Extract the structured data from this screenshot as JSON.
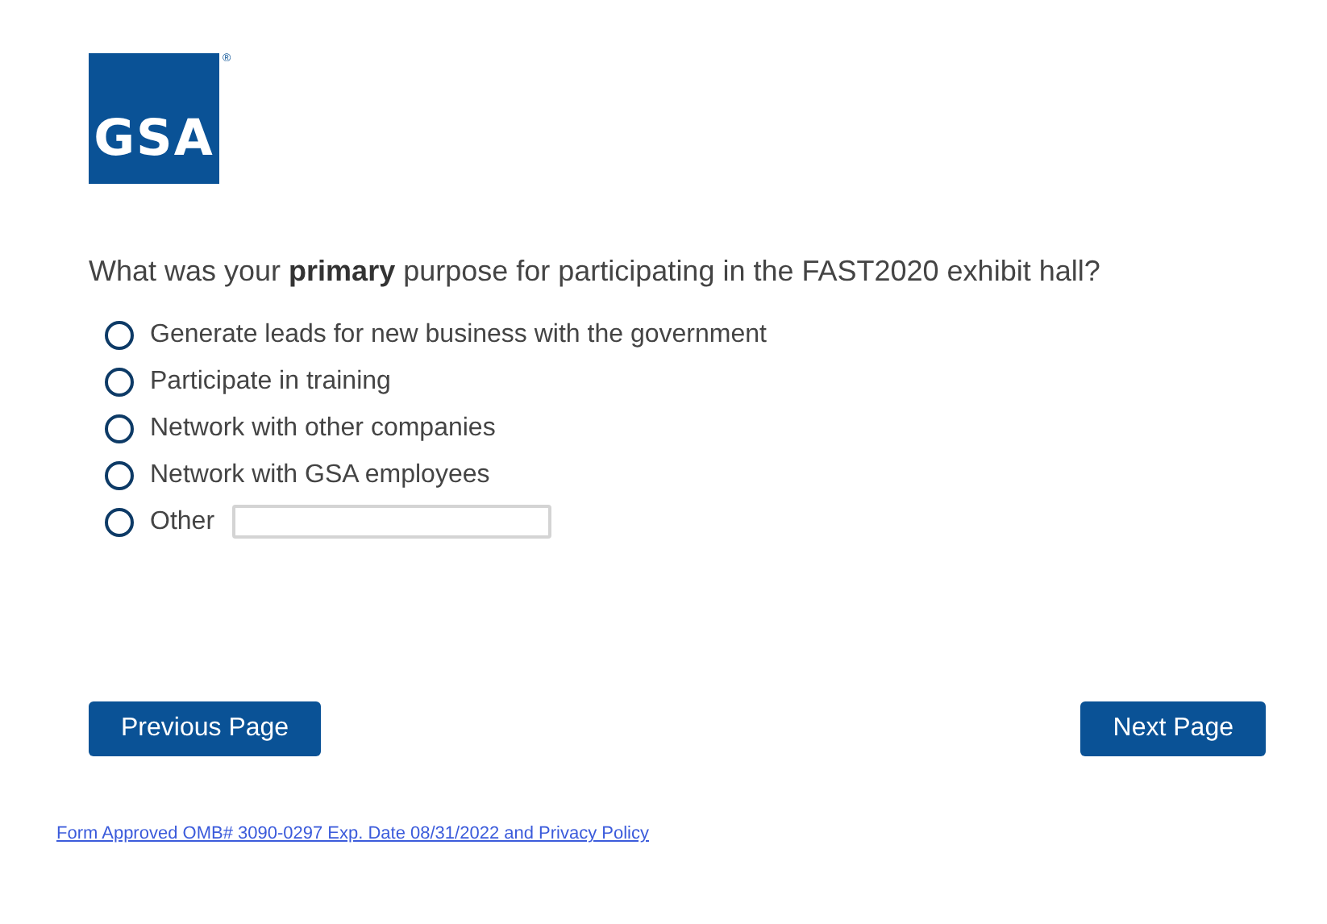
{
  "logo": {
    "text": "GSA",
    "registered_mark": "®"
  },
  "question": "What was your **primary** purpose for participating in the FAST2020 exhibit hall?",
  "options": [
    {
      "label": "Generate leads for new business with the government",
      "selected": false,
      "kind": "plain"
    },
    {
      "label": "Participate in training",
      "selected": false,
      "kind": "plain"
    },
    {
      "label": "Network with other companies",
      "selected": false,
      "kind": "plain"
    },
    {
      "label": "Network with GSA employees",
      "selected": false,
      "kind": "plain"
    },
    {
      "label": "Other",
      "selected": false,
      "kind": "other"
    }
  ],
  "buttons": [
    {
      "label": "Previous Page"
    },
    {
      "label": "Next Page"
    }
  ],
  "footer_link": "Form Approved OMB# 3090-0297 Exp. Date 08/31/2022 and Privacy Policy"
}
